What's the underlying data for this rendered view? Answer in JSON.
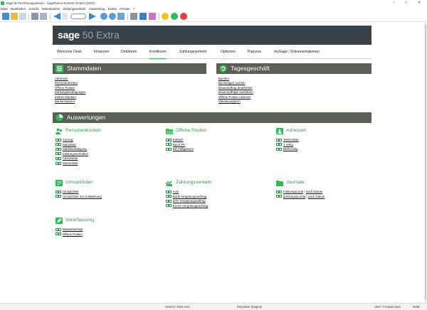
{
  "window": {
    "title": "Sage 50 Rechnungswesen - SageDemo Kirstest GmbH (2022)",
    "controls": [
      "–",
      "□",
      "✕"
    ]
  },
  "menu": [
    "Datei",
    "Bearbeiten",
    "Ansicht",
    "Nebenbücher",
    "Zahlungsverkehr",
    "Auswertung",
    "Extras",
    "Fenster",
    "?"
  ],
  "toolbar": {
    "icons": [
      "home-icon",
      "folder-icon",
      "document-icon",
      "print-icon",
      "print-preview-icon",
      "back-icon",
      "page-input",
      "zoom-in-icon",
      "zoom-out-icon",
      "image-icon",
      "tools-icon",
      "grid-icon",
      "bookmark-icon",
      "lightbulb-icon",
      "help-icon",
      "close-icon"
    ]
  },
  "brand": {
    "sage": "sage",
    "product": " 50 Extra"
  },
  "nav": [
    "Welcome Desk",
    "Finanzen",
    "Debitoren",
    "Kreditoren",
    "Zahlungsverkehr",
    "Optionen",
    "Papyrus",
    "mySage / Dokumentationen"
  ],
  "nav_active": "Kreditoren",
  "stammdaten": {
    "title": "Stammdaten",
    "links": [
      "Adressen",
      "Personenkonten",
      "Offene Posten",
      "Zahlungsbedingungen",
      "Interne Banken",
      "Bankenstamm"
    ]
  },
  "tagesgeschaeft": {
    "title": "Tagesgeschäft",
    "links": [
      "Buchen",
      "Buchungen suchen",
      "Dauerauftrag bearbeiten",
      "Daueraufträge ausführen",
      "Offene Posten einlesen",
      "Valutaausgleich"
    ]
  },
  "auswertungen": {
    "title": "Auswertungen",
    "personenkonten": {
      "title": "Personenkonten",
      "items": [
        "Auszug",
        "Saldoliste",
        "Saldobestätigung",
        "Zahlungsverhalten",
        "Adressliste",
        "Stammliste"
      ]
    },
    "offene_posten": {
      "title": "Offene Posten",
      "items": [
        "Einfach",
        "Nach PK",
        "Mit Fälligkeiten"
      ]
    },
    "adressen": {
      "title": "Adressen",
      "items": [
        "Telefonliste",
        "1-zeilig",
        "Mehrzeilig"
      ]
    },
    "umsatzlisten": {
      "title": "Umsatzlisten",
      "items": [
        "Umsatzliste",
        "Umsatzliste mit Leitwährung"
      ]
    },
    "zahlungsverkehr": {
      "title": "Zahlungsverkehr",
      "items": [
        "Avis",
        "Bank-Vergütungsauftrag",
        "DTA-Vergütungsauftrag",
        "EZAG-Vergütungsauftrag"
      ]
    },
    "journale": {
      "title": "Journale",
      "items": [
        {
          "a": "Fakturajournal",
          "sep": " / ",
          "b": "nach Datum"
        },
        {
          "a": "Zahlungsjournal",
          "sep": " / ",
          "b": "nach Datum"
        }
      ]
    },
    "vorerfassung": {
      "title": "Vorerfassung",
      "items": [
        "Mitarbeiterliste",
        "Offene Posten"
      ]
    }
  },
  "status": {
    "version": "Version: 2022 AU1",
    "engine": "Pervasive (Engine)",
    "user": "User: T-Kunde Dam",
    "mode": "NUM"
  },
  "colors": {
    "accent": "#2dbb54",
    "section_header": "#5a6058",
    "banner": "#3b4247"
  }
}
